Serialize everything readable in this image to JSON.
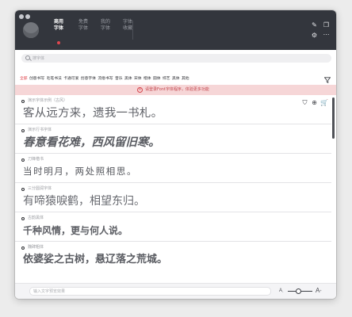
{
  "tabs": [
    {
      "label": "商用字体",
      "active": true
    },
    {
      "label": "免费字体",
      "active": false
    },
    {
      "label": "我的字体",
      "active": false
    },
    {
      "label": "字体收藏",
      "active": false
    }
  ],
  "search": {
    "placeholder": "搜字体"
  },
  "categories": [
    "全部",
    "创意书写",
    "毛笔书法",
    "卡通可爱",
    "创意字体",
    "流俗书写",
    "音乐",
    "黑体",
    "宋体",
    "楷体",
    "圆体",
    "综艺",
    "黑体",
    "其他"
  ],
  "notice": {
    "text": "请登录Font字体程序，体验更多功能"
  },
  "fonts": [
    {
      "name": "演示字体示例（古风）",
      "sample": "客从远方来，遗我一书札。"
    },
    {
      "name": "演示行书字体",
      "sample": "春意看花难，西风留旧寒。"
    },
    {
      "name": "刀锋楷书",
      "sample": "当时明月，两处照相思。"
    },
    {
      "name": "三分圆润字体",
      "sample": "有啼猿唳鹤，相望东归。"
    },
    {
      "name": "古韵黑体",
      "sample": "千种风情，更与何人说。"
    },
    {
      "name": "魏碑粗体",
      "sample": "依婆娑之古树，悬辽落之荒城。"
    }
  ],
  "bottom": {
    "preview_placeholder": "输入文字预览效果",
    "size_small_label": "A",
    "size_big_label": "A",
    "size_sup_minus": "-",
    "size_sup_plus": "+",
    "size_level": 0.45
  },
  "colors": {
    "accent": "#e0474f",
    "topbar": "#33363d",
    "notice_bg": "#f6d6d7"
  }
}
